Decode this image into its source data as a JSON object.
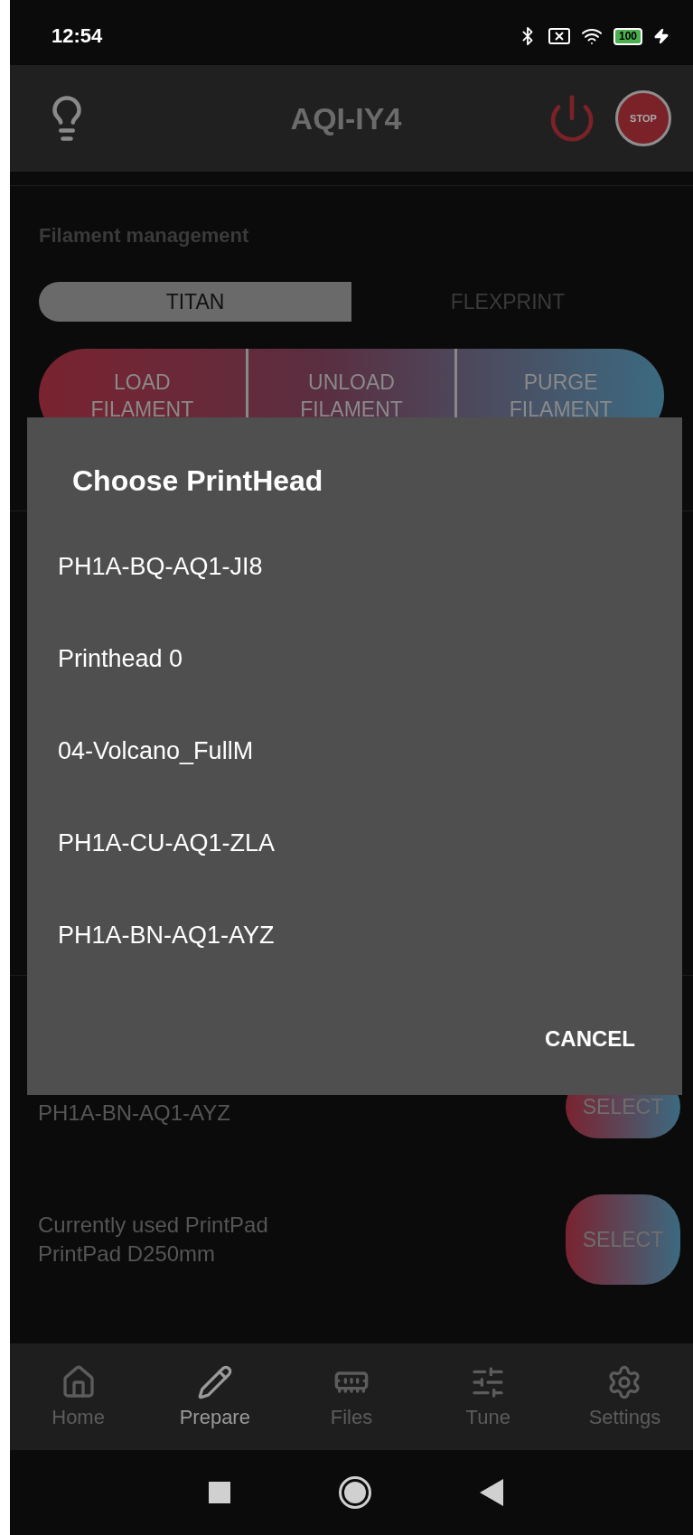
{
  "status_bar": {
    "time": "12:54",
    "battery": "100"
  },
  "app_bar": {
    "title": "AQI-IY4",
    "stop_label": "STOP"
  },
  "filament": {
    "heading": "Filament management",
    "tabs": [
      {
        "label": "TITAN",
        "selected": true
      },
      {
        "label": "FLEXPRINT",
        "selected": false
      }
    ],
    "actions": [
      "LOAD FILAMENT",
      "UNLOAD FILAMENT",
      "PURGE FILAMENT"
    ]
  },
  "printhead": {
    "value": "PH1A-BN-AQ1-AYZ",
    "button": "SELECT"
  },
  "printpad": {
    "label": "Currently used PrintPad",
    "value": "PrintPad D250mm",
    "button": "SELECT"
  },
  "bottom_nav": [
    {
      "label": "Home",
      "selected": false
    },
    {
      "label": "Prepare",
      "selected": true
    },
    {
      "label": "Files",
      "selected": false
    },
    {
      "label": "Tune",
      "selected": false
    },
    {
      "label": "Settings",
      "selected": false
    }
  ],
  "dialog": {
    "title": "Choose PrintHead",
    "options": [
      "PH1A-BQ-AQ1-JI8",
      "Printhead 0",
      "04-Volcano_FullM",
      "PH1A-CU-AQ1-ZLA",
      "PH1A-BN-AQ1-AYZ"
    ],
    "cancel": "CANCEL"
  }
}
